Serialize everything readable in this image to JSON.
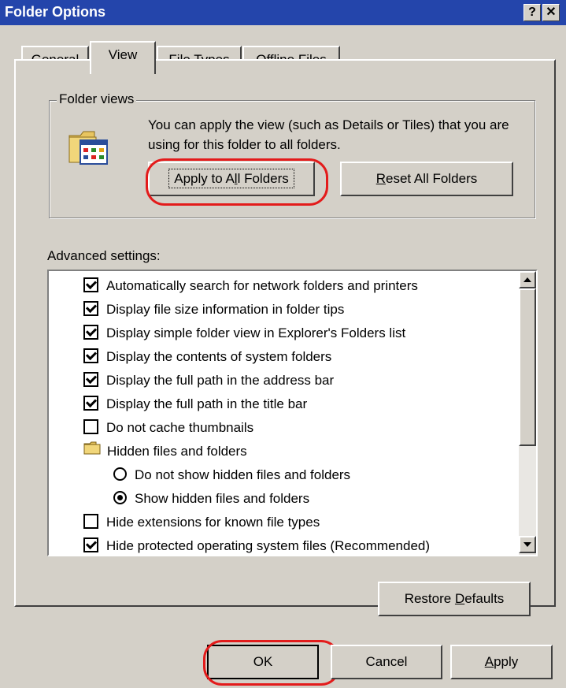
{
  "window": {
    "title": "Folder Options",
    "help_glyph": "?",
    "close_glyph": "✕"
  },
  "tabs": [
    {
      "label": "General",
      "active": false
    },
    {
      "label": "View",
      "active": true
    },
    {
      "label": "File Types",
      "active": false
    },
    {
      "label": "Offline Files",
      "active": false
    }
  ],
  "folder_views": {
    "legend": "Folder views",
    "description": "You can apply the view (such as Details or Tiles) that you are using for this folder to all folders.",
    "apply_button": {
      "pre": "Apply to A",
      "ul": "l",
      "post": "l Folders"
    },
    "reset_button": {
      "pre": "",
      "ul": "R",
      "post": "eset All Folders"
    }
  },
  "advanced": {
    "label": "Advanced settings:",
    "items": [
      {
        "type": "checkbox",
        "checked": true,
        "label": "Automatically search for network folders and printers"
      },
      {
        "type": "checkbox",
        "checked": true,
        "label": "Display file size information in folder tips"
      },
      {
        "type": "checkbox",
        "checked": true,
        "label": "Display simple folder view in Explorer's Folders list"
      },
      {
        "type": "checkbox",
        "checked": true,
        "label": "Display the contents of system folders"
      },
      {
        "type": "checkbox",
        "checked": true,
        "label": "Display the full path in the address bar"
      },
      {
        "type": "checkbox",
        "checked": true,
        "label": "Display the full path in the title bar"
      },
      {
        "type": "checkbox",
        "checked": false,
        "label": "Do not cache thumbnails"
      },
      {
        "type": "folder",
        "label": "Hidden files and folders"
      },
      {
        "type": "radio",
        "selected": false,
        "label": "Do not show hidden files and folders"
      },
      {
        "type": "radio",
        "selected": true,
        "label": "Show hidden files and folders"
      },
      {
        "type": "checkbox",
        "checked": false,
        "label": "Hide extensions for known file types"
      },
      {
        "type": "checkbox",
        "checked": true,
        "label": "Hide protected operating system files (Recommended)"
      }
    ]
  },
  "restore_button": {
    "pre": "Restore ",
    "ul": "D",
    "post": "efaults"
  },
  "footer": {
    "ok": "OK",
    "cancel": "Cancel",
    "apply": {
      "pre": "",
      "ul": "A",
      "post": "pply"
    }
  },
  "colors": {
    "titlebar": "#2445ab",
    "highlight_circle": "#e31b1b",
    "face": "#d4d0c8"
  }
}
